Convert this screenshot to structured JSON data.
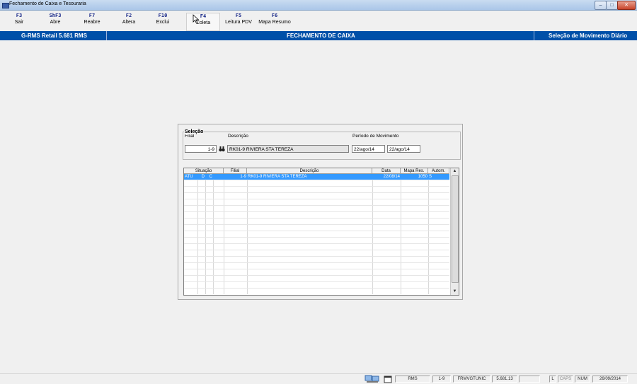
{
  "window": {
    "title": "Fechamento de Caixa e Tesouraria",
    "min": "–",
    "max": "□",
    "close": "✕"
  },
  "toolbar": [
    {
      "key": "F3",
      "label": "Sair"
    },
    {
      "key": "ShF3",
      "label": "Abre"
    },
    {
      "key": "F7",
      "label": "Reabre"
    },
    {
      "key": "F2",
      "label": "Altera"
    },
    {
      "key": "F10",
      "label": "Exclui"
    },
    {
      "key": "F4",
      "label": "Coleta"
    },
    {
      "key": "F5",
      "label": "Leitura PDV"
    },
    {
      "key": "F6",
      "label": "Mapa Resumo"
    }
  ],
  "header": {
    "app": "G-RMS Retail 5.681 RMS",
    "title": "FECHAMENTO DE CAIXA",
    "context": "Seleção de Movimento Diário"
  },
  "selecao": {
    "group_label": "Seleção",
    "filial_label": "Filial",
    "filial_value": "1-9",
    "descricao_label": "Descrição",
    "descricao_value": "RK01-9 RIVIERA STA TEREZA",
    "periodo_label": "Período de Movimento",
    "periodo_de": "22/ago/14",
    "periodo_ate": "22/ago/14"
  },
  "grid": {
    "columns": [
      "Situação",
      "Filial",
      "Descrição",
      "Data",
      "Mapa Res.",
      "Autom."
    ],
    "rows": [
      {
        "sit1": "ATU",
        "sit2": "D",
        "sit3": "C",
        "filial": "1-9",
        "descricao": "RK01-9 RIVIERA STA TEREZA",
        "data": "22/08/14",
        "mapa": "1050",
        "autom": "S"
      }
    ]
  },
  "status": {
    "user": "RMS",
    "filial": "1-9",
    "program": "FRMVGTUNIC",
    "version": "5.681.13",
    "caps_l": "L",
    "caps": "CAPS",
    "num": "NUM",
    "date": "26/09/2014"
  }
}
